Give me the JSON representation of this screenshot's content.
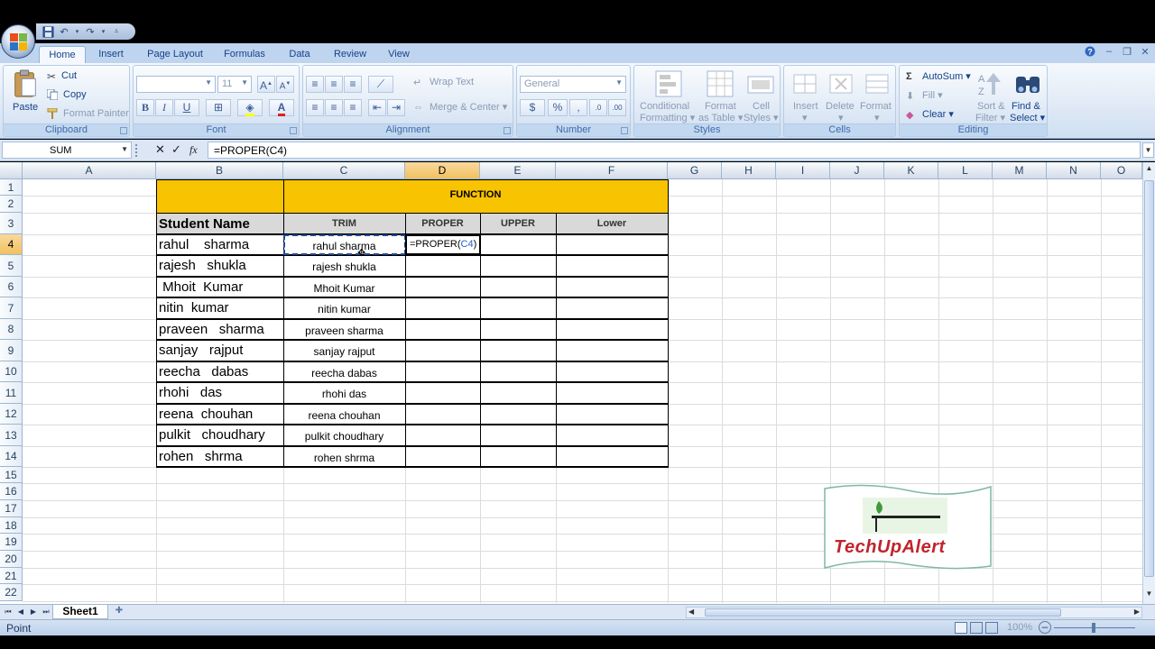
{
  "qat": {
    "save": "save-icon",
    "undo": "undo-icon",
    "redo": "redo-icon"
  },
  "tabs": [
    "Home",
    "Insert",
    "Page Layout",
    "Formulas",
    "Data",
    "Review",
    "View"
  ],
  "ribbon": {
    "clipboard": {
      "label": "Clipboard",
      "paste": "Paste",
      "cut": "Cut",
      "copy": "Copy",
      "format_painter": "Format Painter"
    },
    "font": {
      "label": "Font",
      "font_name": "",
      "font_size": "11",
      "bold": "B",
      "italic": "I",
      "underline": "U",
      "grow": "A",
      "shrink": "A"
    },
    "alignment": {
      "label": "Alignment",
      "wrap_text": "Wrap Text",
      "merge_center": "Merge & Center"
    },
    "number": {
      "label": "Number",
      "format": "General",
      "currency": "$",
      "percent": "%",
      "comma": ","
    },
    "styles": {
      "label": "Styles",
      "conditional": "Conditional",
      "conditional2": "Formatting",
      "format_as_table": "Format",
      "format_as_table2": "as Table",
      "cell_styles": "Cell",
      "cell_styles2": "Styles"
    },
    "cells": {
      "label": "Cells",
      "insert": "Insert",
      "delete": "Delete",
      "format": "Format"
    },
    "editing": {
      "label": "Editing",
      "autosum": "AutoSum",
      "fill": "Fill",
      "clear": "Clear",
      "sort": "Sort &",
      "sort2": "Filter",
      "find": "Find &",
      "find2": "Select"
    }
  },
  "formula_bar": {
    "name_box": "SUM",
    "cancel": "✕",
    "enter": "✓",
    "fx": "fx",
    "formula": "=PROPER(C4)"
  },
  "columns": [
    "A",
    "B",
    "C",
    "D",
    "E",
    "F",
    "G",
    "H",
    "I",
    "J",
    "K",
    "L",
    "M",
    "N",
    "O"
  ],
  "rows": [
    "1",
    "2",
    "3",
    "4",
    "5",
    "6",
    "7",
    "8",
    "9",
    "10",
    "11",
    "12",
    "13",
    "14",
    "15",
    "16",
    "17",
    "18",
    "19",
    "20",
    "21",
    "22"
  ],
  "table": {
    "function_header": "FUNCTION",
    "headers": {
      "name": "Student Name",
      "trim": "TRIM",
      "proper": "PROPER",
      "upper": "UPPER",
      "lower": "Lower"
    },
    "names": [
      "rahul    sharma",
      "rajesh   shukla",
      " Mhoit  Kumar",
      "nitin  kumar",
      "praveen   sharma",
      "sanjay   rajput",
      "reecha   dabas",
      "rhohi   das",
      "reena  chouhan",
      "pulkit   choudhary",
      "rohen   shrma"
    ],
    "trimmed": [
      "rahul sharma",
      "rajesh shukla",
      "Mhoit Kumar",
      "nitin kumar",
      "praveen sharma",
      "sanjay rajput",
      "reecha dabas",
      "rhohi das",
      "reena chouhan",
      "pulkit choudhary",
      "rohen shrma"
    ],
    "edit_text_a": "=PROPER(",
    "edit_text_b": "C4",
    "edit_text_c": ")"
  },
  "sheet_tab": "Sheet1",
  "status": "Point",
  "zoom": "100%",
  "watermark": "TechUpAlert"
}
